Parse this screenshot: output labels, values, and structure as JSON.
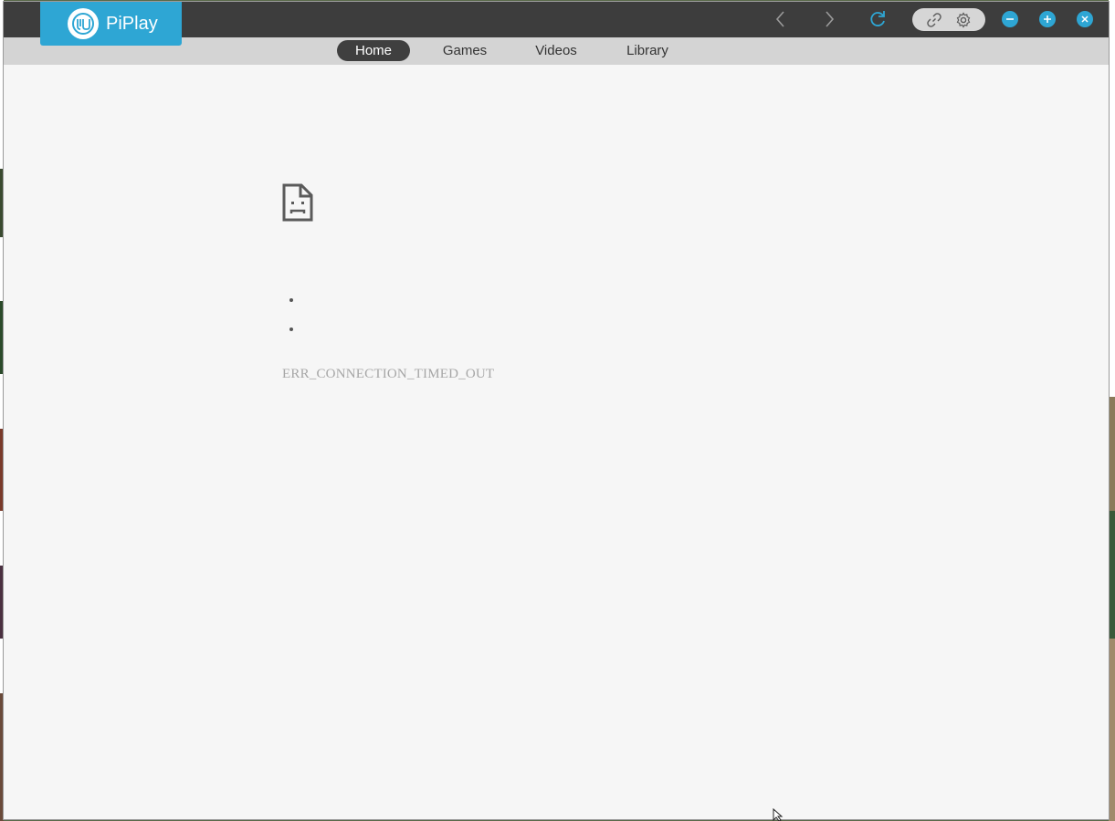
{
  "app": {
    "name": "PiPlay",
    "logo_icon": "piplay-logo-icon",
    "accent_color": "#2ea6d4"
  },
  "titlebar": {
    "back_icon": "chevron-left-icon",
    "forward_icon": "chevron-right-icon",
    "reload_icon": "refresh-icon",
    "link_icon": "link-icon",
    "settings_icon": "gear-icon",
    "minimize_icon": "minus-icon",
    "maximize_icon": "plus-icon",
    "close_icon": "close-icon"
  },
  "tabs": [
    {
      "label": "Home",
      "active": true
    },
    {
      "label": "Games",
      "active": false
    },
    {
      "label": "Videos",
      "active": false
    },
    {
      "label": "Library",
      "active": false
    }
  ],
  "error_page": {
    "icon": "sad-document-icon",
    "suggestions": [
      "",
      ""
    ],
    "error_code": "ERR_CONNECTION_TIMED_OUT"
  }
}
